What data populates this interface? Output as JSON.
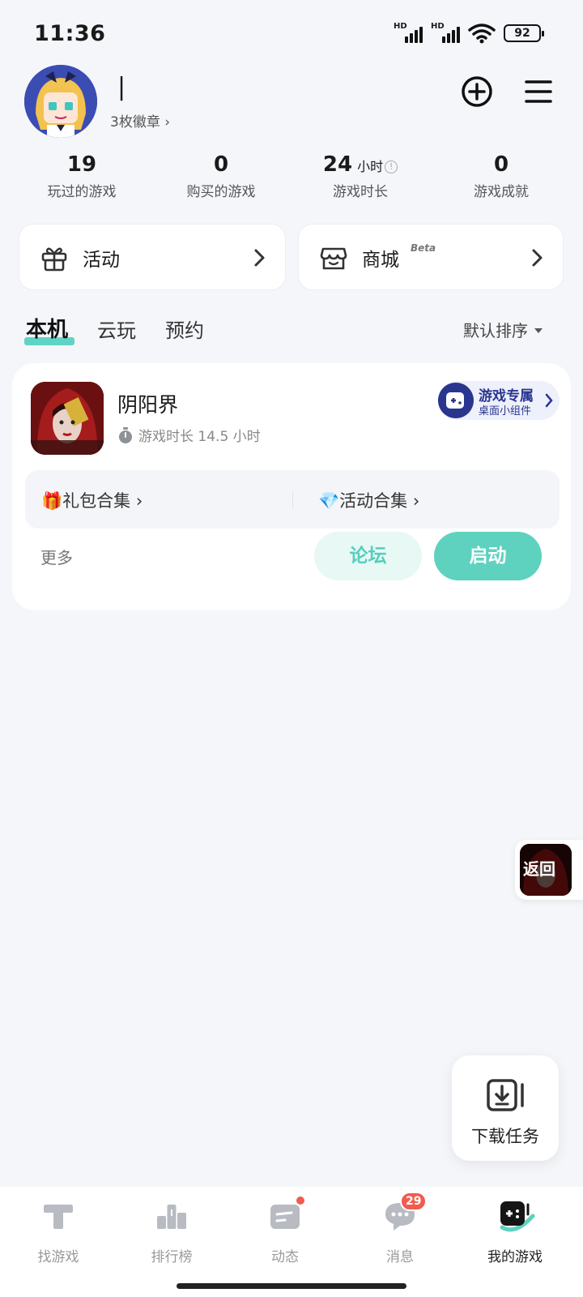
{
  "status_bar": {
    "time": "11:36",
    "signal1_label": "HD",
    "signal2_label": "HD",
    "battery": "92",
    "icons": [
      "signal-icon",
      "signal-icon",
      "wifi-icon",
      "battery-icon"
    ]
  },
  "profile": {
    "username": "|",
    "badges": "3枚徽章",
    "actions": [
      "add-circle-icon",
      "menu-icon"
    ]
  },
  "stats": [
    {
      "value": "19",
      "unit": "",
      "label": "玩过的游戏"
    },
    {
      "value": "0",
      "unit": "",
      "label": "购买的游戏"
    },
    {
      "value": "24",
      "unit": "小时",
      "label": "游戏时长"
    },
    {
      "value": "0",
      "unit": "",
      "label": "游戏成就"
    }
  ],
  "cards": {
    "activity": {
      "label": "活动",
      "icon": "gift-icon"
    },
    "shop": {
      "label": "商城",
      "beta": "Beta",
      "icon": "shop-icon"
    }
  },
  "tabs": [
    {
      "label": "本机",
      "active": true
    },
    {
      "label": "云玩",
      "active": false
    },
    {
      "label": "预约",
      "active": false
    }
  ],
  "sort": {
    "label": "默认排序"
  },
  "game": {
    "title": "阴阳界",
    "play_time": "游戏时长 14.5 小时",
    "widget_title": "游戏专属",
    "widget_subtitle": "桌面小组件",
    "gift_link": "🎁礼包合集",
    "event_link": "💎活动合集",
    "more": "更多",
    "forum_button": "论坛",
    "start_button": "启动"
  },
  "float_back": {
    "label": "返回"
  },
  "download": {
    "label": "下载任务"
  },
  "bottom_nav": [
    {
      "label": "找游戏",
      "icon": "find-game-icon"
    },
    {
      "label": "排行榜",
      "icon": "leaderboard-icon"
    },
    {
      "label": "动态",
      "icon": "feed-icon",
      "dot": true
    },
    {
      "label": "消息",
      "icon": "message-icon",
      "badge": "29"
    },
    {
      "label": "我的游戏",
      "icon": "my-games-icon",
      "active": true
    }
  ],
  "colors": {
    "accent": "#5ed2bf",
    "accent_light": "#e7f8f5",
    "badge_red": "#f05c4f",
    "background": "#f4f6f9"
  }
}
